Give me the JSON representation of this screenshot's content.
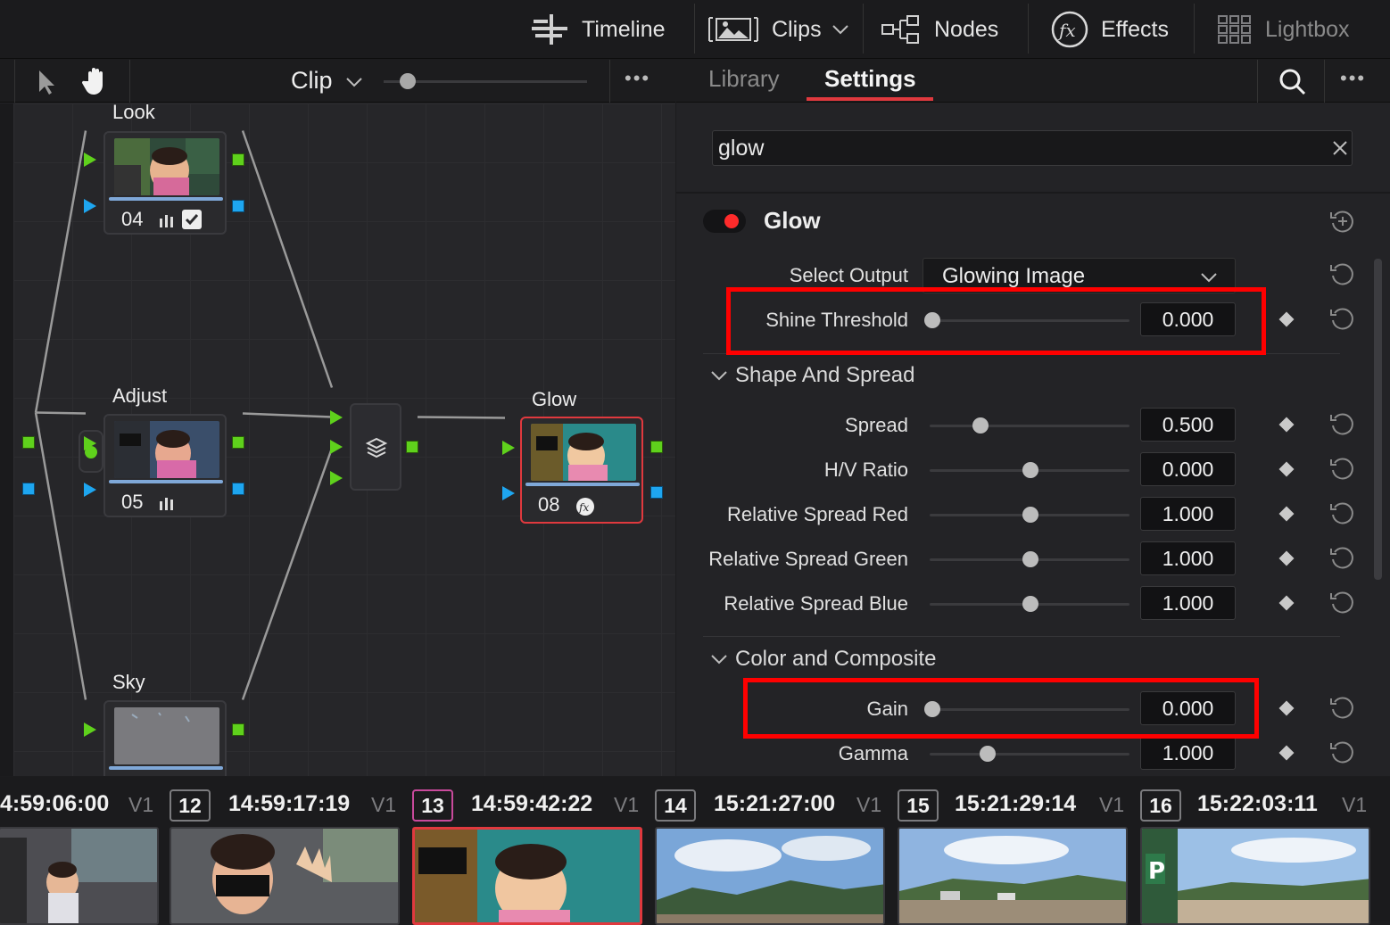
{
  "topbar": {
    "timeline": "Timeline",
    "clips": "Clips",
    "nodes": "Nodes",
    "effects": "Effects",
    "lightbox": "Lightbox"
  },
  "node_toolbar": {
    "mode": "Clip",
    "more": "•••"
  },
  "nodes": {
    "look": {
      "label": "Look",
      "number": "04"
    },
    "adjust": {
      "label": "Adjust",
      "number": "05"
    },
    "glow": {
      "label": "Glow",
      "number": "08"
    },
    "sky": {
      "label": "Sky"
    }
  },
  "settings": {
    "tabs": {
      "library": "Library",
      "settings": "Settings"
    },
    "more": "•••",
    "search": {
      "value": "glow"
    },
    "effect_title": "Glow",
    "select_output": {
      "label": "Select Output",
      "value": "Glowing Image"
    },
    "shine_threshold": {
      "label": "Shine Threshold",
      "value": "0.000"
    },
    "section_shape": "Shape And Spread",
    "spread": {
      "label": "Spread",
      "value": "0.500"
    },
    "hv_ratio": {
      "label": "H/V Ratio",
      "value": "0.000"
    },
    "rel_red": {
      "label": "Relative Spread Red",
      "value": "1.000"
    },
    "rel_green": {
      "label": "Relative Spread Green",
      "value": "1.000"
    },
    "rel_blue": {
      "label": "Relative Spread Blue",
      "value": "1.000"
    },
    "section_color": "Color and Composite",
    "gain": {
      "label": "Gain",
      "value": "0.000"
    },
    "gamma": {
      "label": "Gamma",
      "value": "1.000"
    }
  },
  "timeline": {
    "clips": [
      {
        "num": "",
        "tc": "4:59:06:00",
        "track": "V1"
      },
      {
        "num": "12",
        "tc": "14:59:17:19",
        "track": "V1"
      },
      {
        "num": "13",
        "tc": "14:59:42:22",
        "track": "V1"
      },
      {
        "num": "14",
        "tc": "15:21:27:00",
        "track": "V1"
      },
      {
        "num": "15",
        "tc": "15:21:29:14",
        "track": "V1"
      },
      {
        "num": "16",
        "tc": "15:22:03:11",
        "track": "V1"
      }
    ]
  },
  "colors": {
    "accent_red": "#e0393e",
    "highlight_red": "#ff0000",
    "port_green": "#5fd11c",
    "port_blue": "#1ea6f0"
  }
}
